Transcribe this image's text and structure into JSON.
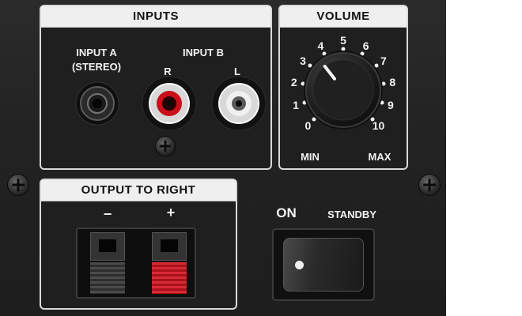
{
  "inputs_section": {
    "title": "INPUTS",
    "input_a_label": "INPUT A\n(STEREO)",
    "input_b_label": "INPUT B",
    "r_label": "R",
    "l_label": "L",
    "colors": {
      "right_jack": "#c8101a",
      "left_jack": "#f0f0f0"
    }
  },
  "volume_section": {
    "title": "VOLUME",
    "scale": [
      "0",
      "1",
      "2",
      "3",
      "4",
      "5",
      "6",
      "7",
      "8",
      "9",
      "10"
    ],
    "min_label": "MIN",
    "max_label": "MAX",
    "level": 3.6
  },
  "output_section": {
    "title": "OUTPUT TO RIGHT",
    "minus_label": "−",
    "plus_label": "+",
    "colors": {
      "negative": "#3a3a3a",
      "positive": "#c8202a"
    }
  },
  "power": {
    "on_label": "ON",
    "standby_label": "STANDBY"
  }
}
